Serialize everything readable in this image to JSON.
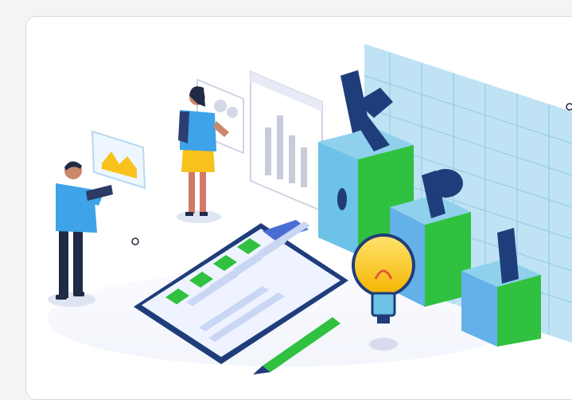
{
  "card": {
    "kind": "illustration",
    "subject": "kpi-dashboard-isometric",
    "kpi_letters": [
      "K",
      "P",
      "I"
    ],
    "checklist_items_checked": 4,
    "colors": {
      "sky": "#8fd0ec",
      "green": "#2fc13f",
      "navy": "#1f3d7a",
      "bulb": "#f7c21b",
      "panel": "#ffffff"
    }
  }
}
